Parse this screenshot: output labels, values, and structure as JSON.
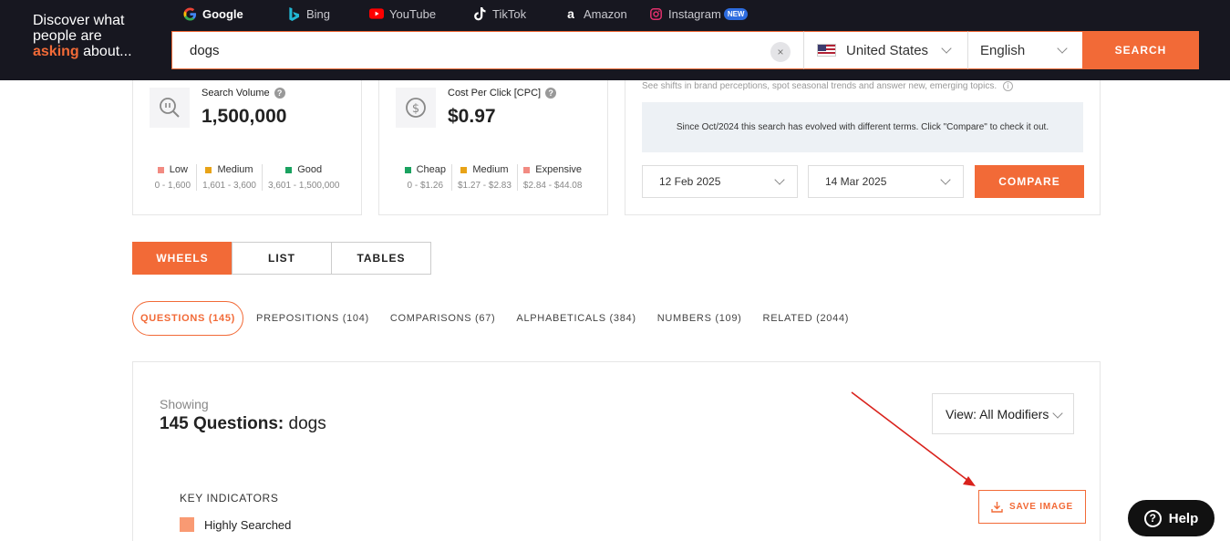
{
  "header": {
    "tagline_line1": "Discover what",
    "tagline_line2": "people are",
    "tagline_accent": "asking",
    "tagline_rest": " about...",
    "engines": [
      {
        "label": "Google",
        "icon": "google-icon",
        "active": true
      },
      {
        "label": "Bing",
        "icon": "bing-icon",
        "active": false
      },
      {
        "label": "YouTube",
        "icon": "youtube-icon",
        "active": false
      },
      {
        "label": "TikTok",
        "icon": "tiktok-icon",
        "active": false
      },
      {
        "label": "Amazon",
        "icon": "amazon-icon",
        "active": false
      },
      {
        "label": "Instagram",
        "icon": "instagram-icon",
        "active": false
      }
    ],
    "new_badge": "NEW",
    "search_value": "dogs",
    "clear_label": "×",
    "country": "United States",
    "language": "English",
    "search_button": "SEARCH"
  },
  "metrics": {
    "volume": {
      "label": "Search Volume",
      "value": "1,500,000",
      "legend": [
        {
          "name": "Low",
          "range": "0 - 1,600",
          "color": "#f28b82"
        },
        {
          "name": "Medium",
          "range": "1,601 - 3,600",
          "color": "#e8a317"
        },
        {
          "name": "Good",
          "range": "3,601 - 1,500,000",
          "color": "#1aa260"
        }
      ]
    },
    "cpc": {
      "label": "Cost Per Click [CPC]",
      "value": "$0.97",
      "legend": [
        {
          "name": "Cheap",
          "range": "0 - $1.26",
          "color": "#1aa260"
        },
        {
          "name": "Medium",
          "range": "$1.27 - $2.83",
          "color": "#e8a317"
        },
        {
          "name": "Expensive",
          "range": "$2.84 - $44.08",
          "color": "#f28b82"
        }
      ]
    },
    "trends": {
      "note": "See shifts in brand perceptions, spot seasonal trends and answer new, emerging topics.",
      "evolved": "Since Oct/2024 this search has evolved with different terms. Click \"Compare\" to check it out.",
      "date_from": "12 Feb 2025",
      "date_to": "14 Mar 2025",
      "compare_button": "COMPARE"
    }
  },
  "view_tabs": [
    "WHEELS",
    "LIST",
    "TABLES"
  ],
  "category_tabs": [
    "QUESTIONS (145)",
    "PREPOSITIONS (104)",
    "COMPARISONS (67)",
    "ALPHABETICALS (384)",
    "NUMBERS (109)",
    "RELATED (2044)"
  ],
  "results": {
    "showing": "Showing",
    "title_bold": "145 Questions:",
    "title_term": " dogs",
    "modifier": "View: All Modifiers",
    "key_indicators": "KEY INDICATORS",
    "indicator_label": "Highly Searched",
    "save_button": "SAVE IMAGE"
  },
  "help_button": "Help",
  "colors": {
    "accent": "#f26a37",
    "header_bg": "#171720",
    "annotation_arrow": "#d9221c"
  }
}
